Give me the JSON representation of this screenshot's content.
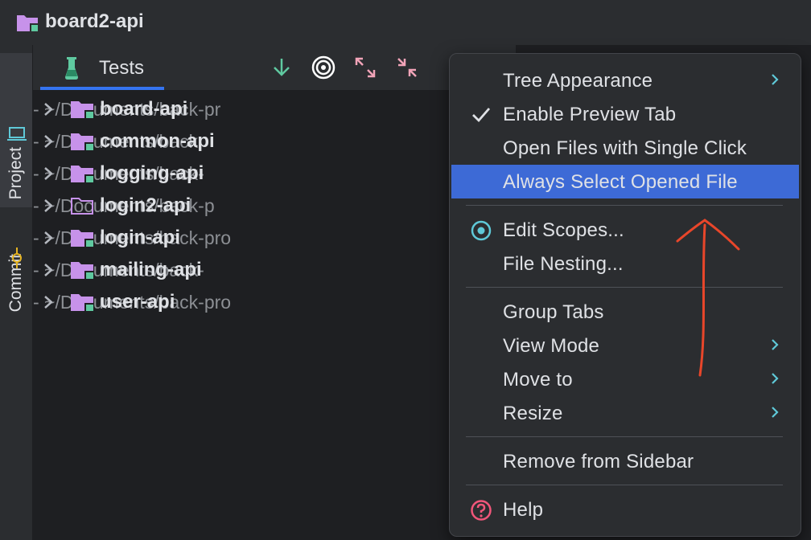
{
  "window": {
    "title": "board2-api"
  },
  "left_stripe": {
    "project_label": "Project",
    "commit_label": "Commit"
  },
  "panel": {
    "tab_label": "Tests",
    "toolbar": [
      "arrow-down-icon",
      "target-icon",
      "expand-all-icon",
      "collapse-all-icon"
    ]
  },
  "tree": {
    "rows": [
      {
        "name": "board-api",
        "path": "- ~/Documents/back-pr",
        "folder": "module"
      },
      {
        "name": "common-api",
        "path": "- ~/Documents/back",
        "folder": "module"
      },
      {
        "name": "logging-api",
        "path": "- ~/Documents/back-",
        "folder": "module"
      },
      {
        "name": "login2-api",
        "path": "- ~/Documents/back-p",
        "folder": "plain"
      },
      {
        "name": "login-api",
        "path": "- ~/Documents/back-pro",
        "folder": "module"
      },
      {
        "name": "mailing-api",
        "path": "- ~/Documents/back-",
        "folder": "module"
      },
      {
        "name": "user-api",
        "path": "- ~/Documents/back-pro",
        "folder": "module"
      }
    ]
  },
  "context_menu": {
    "items": [
      {
        "label": "Tree Appearance",
        "submenu": true
      },
      {
        "label": "Enable Preview Tab",
        "checked": true
      },
      {
        "label": "Open Files with Single Click"
      },
      {
        "label": "Always Select Opened File",
        "selected": true
      },
      {
        "label": "Edit Scopes...",
        "icon": "scope-icon"
      },
      {
        "label": "File Nesting..."
      },
      {
        "label": "Group Tabs"
      },
      {
        "label": "View Mode",
        "submenu": true
      },
      {
        "label": "Move to",
        "submenu": true
      },
      {
        "label": "Resize",
        "submenu": true
      },
      {
        "label": "Remove from Sidebar"
      },
      {
        "label": "Help",
        "icon": "help-icon"
      }
    ]
  },
  "colors": {
    "background": "#1e1f22",
    "panel": "#2b2d30",
    "accent": "#3574f0",
    "selection": "#3d6ad6",
    "folder": "#c792ea",
    "annotation": "#e8462a"
  }
}
